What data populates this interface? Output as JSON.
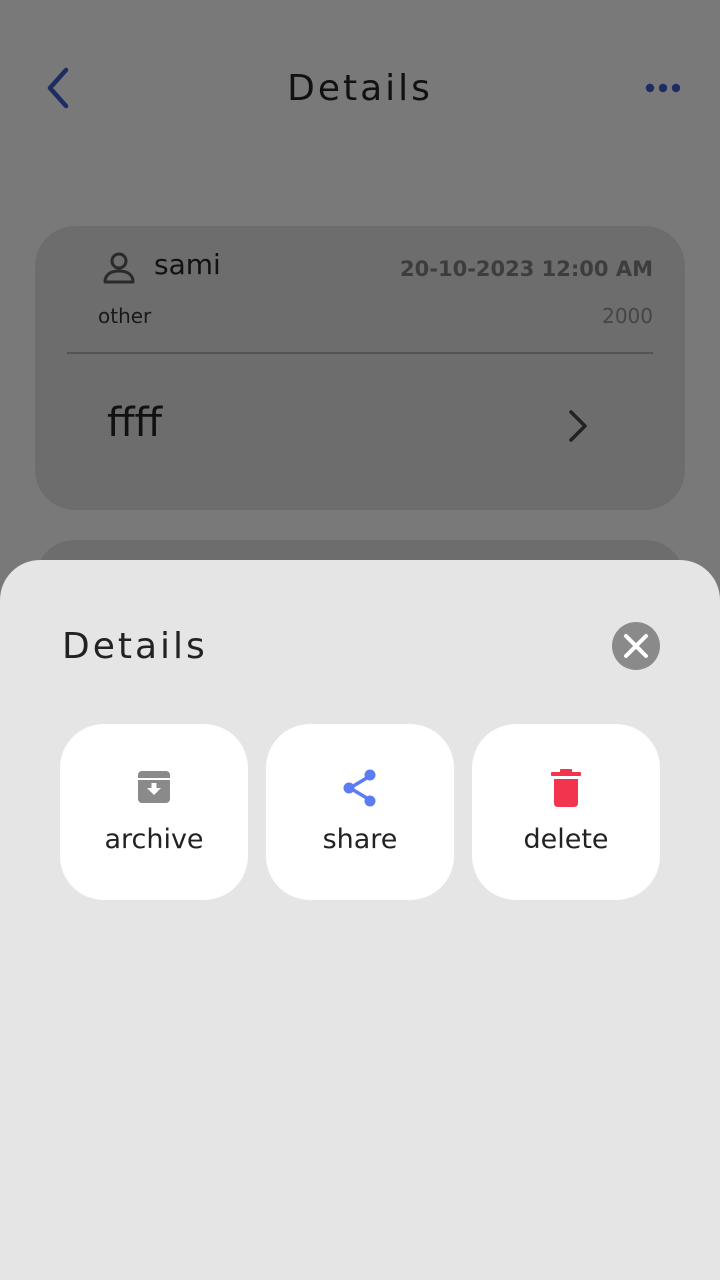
{
  "app": {
    "header": {
      "title": "Details"
    },
    "card": {
      "name": "sami",
      "datetime": "20-10-2023 12:00 AM",
      "category": "other",
      "amount": "2000",
      "note": "ffff"
    }
  },
  "sheet": {
    "title": "Details",
    "actions": [
      {
        "label": "archive",
        "icon": "archive-icon",
        "color": "#8a8a8a"
      },
      {
        "label": "share",
        "icon": "share-icon",
        "color": "#5b7cf2"
      },
      {
        "label": "delete",
        "icon": "trash-icon",
        "color": "#f2344f"
      }
    ]
  },
  "colors": {
    "accent": "#3d58c2",
    "overlay": "rgba(0,0,0,0.5)",
    "sheet_bg": "#e5e5e5",
    "close_bg": "#8a8a8a"
  }
}
